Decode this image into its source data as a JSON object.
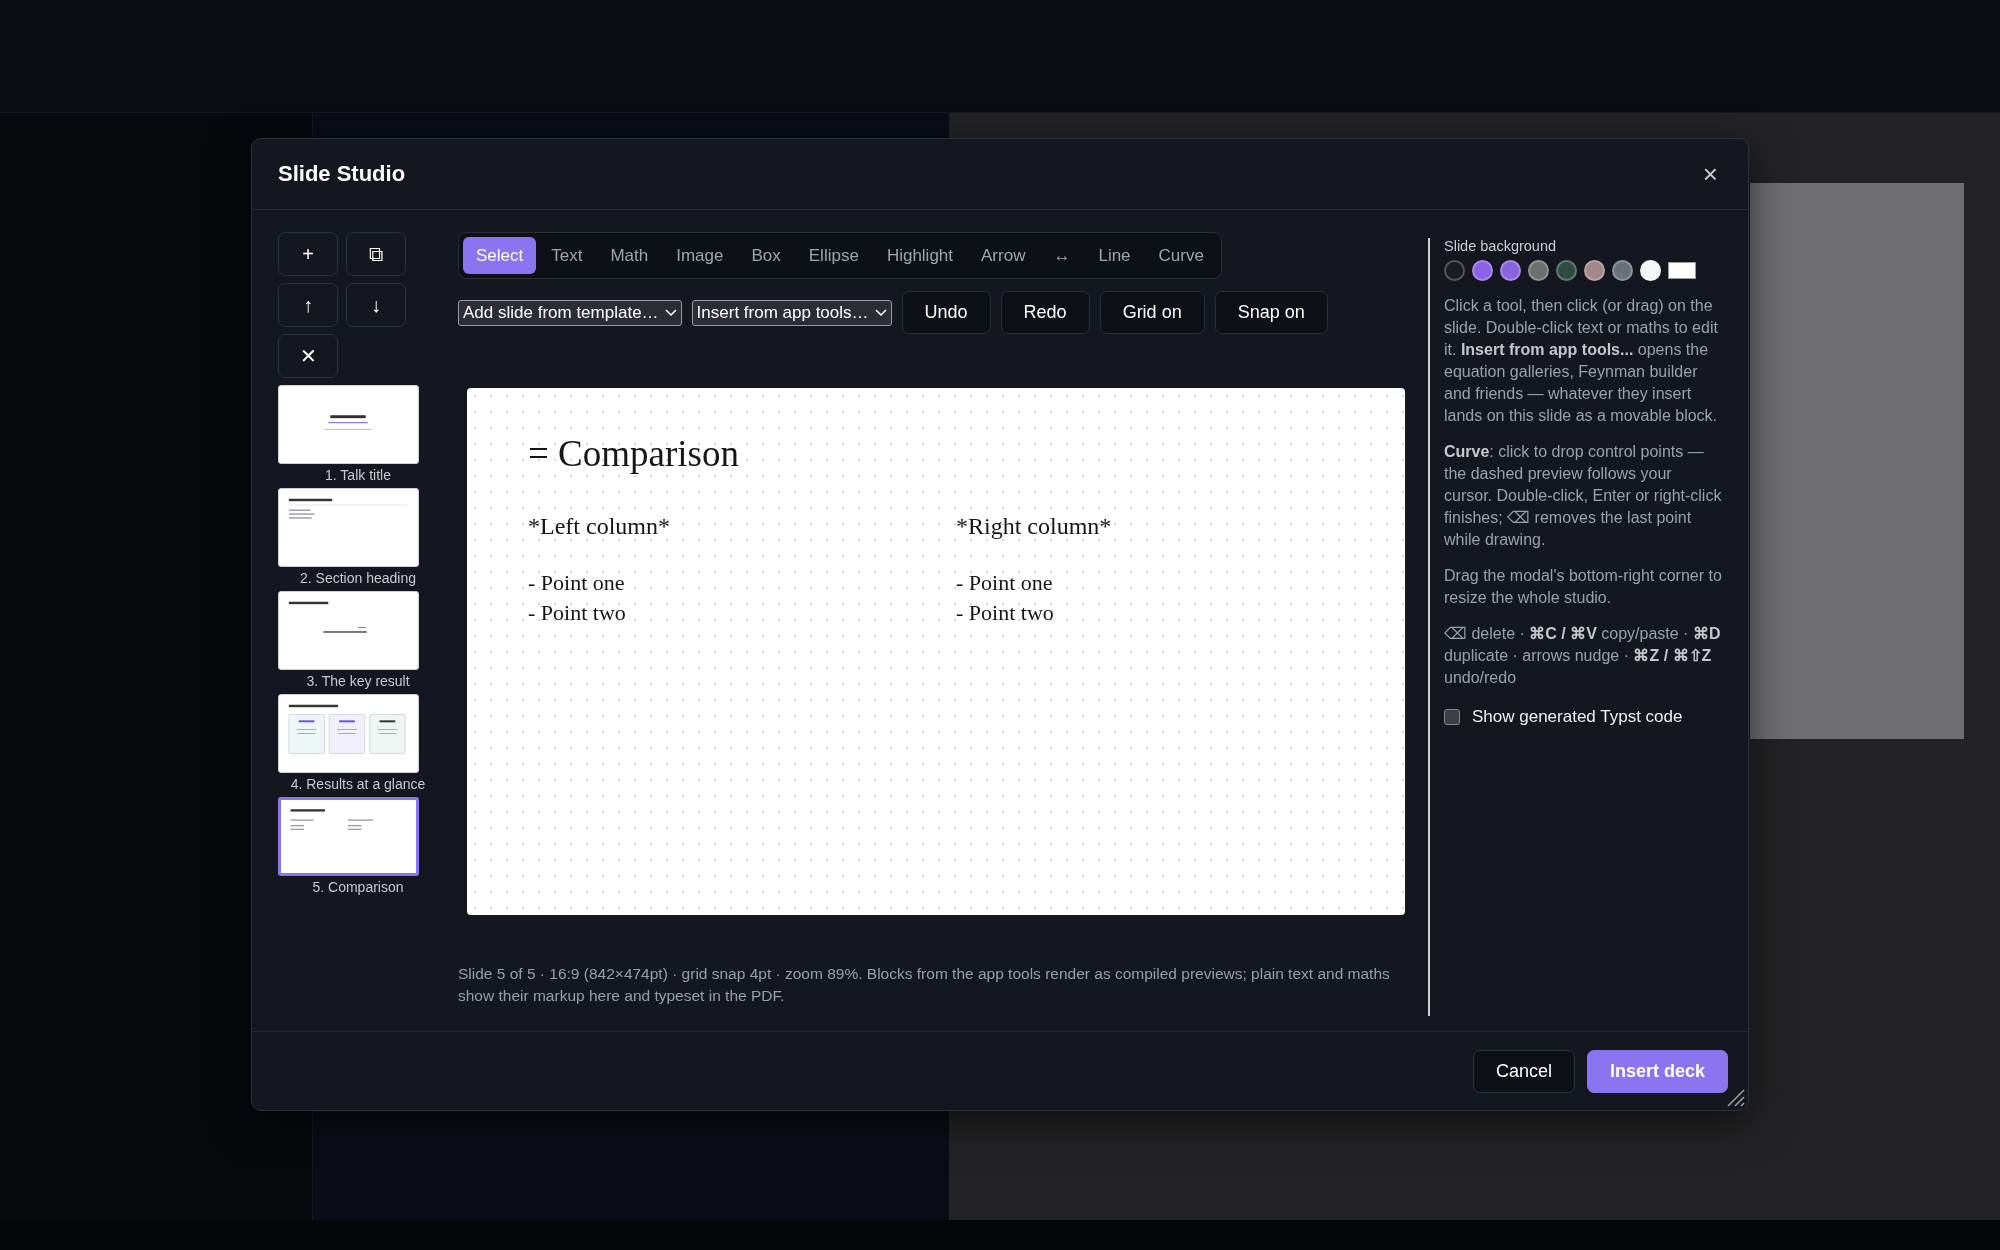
{
  "modal": {
    "title": "Slide Studio",
    "close": "×",
    "slide_actions": [
      "+",
      "⧉",
      "↑",
      "↓",
      "✕"
    ],
    "slides": [
      {
        "kind": "title",
        "label": "1. Talk title",
        "selected": false
      },
      {
        "kind": "bullets",
        "label": "2. Section heading",
        "selected": false
      },
      {
        "kind": "equation",
        "label": "3. The key result",
        "selected": false
      },
      {
        "kind": "stats",
        "label": "4. Results at a glance",
        "selected": false,
        "cards": [
          {
            "color": "#eef7f8"
          },
          {
            "color": "#f1effb"
          },
          {
            "color": "#eef6f4"
          }
        ]
      },
      {
        "kind": "columns",
        "label": "5. Comparison",
        "selected": true
      }
    ],
    "tools": [
      {
        "label": "Select",
        "selected": true
      },
      {
        "label": "Text",
        "selected": false
      },
      {
        "label": "Math",
        "selected": false
      },
      {
        "label": "Image",
        "selected": false
      },
      {
        "label": "Box",
        "selected": false
      },
      {
        "label": "Ellipse",
        "selected": false
      },
      {
        "label": "Highlight",
        "selected": false
      },
      {
        "label": "Arrow",
        "selected": false
      },
      {
        "label": "↔",
        "selected": false
      },
      {
        "label": "Line",
        "selected": false
      },
      {
        "label": "Curve",
        "selected": false
      }
    ],
    "dropdowns": [
      "Add slide from template…",
      "Insert from app tools…"
    ],
    "actions": [
      "Undo",
      "Redo",
      "Grid on",
      "Snap on"
    ],
    "slide": {
      "heading": "= Comparison",
      "columns": [
        {
          "title": "*Left column*",
          "items": [
            "- Point one",
            "- Point two"
          ]
        },
        {
          "title": "*Right column*",
          "items": [
            "- Point one",
            "- Point two"
          ]
        }
      ]
    },
    "caption": "Slide 5 of 5 · 16:9 (842×474pt) · grid snap 4pt · zoom 89%. Blocks from the app tools render as compiled previews; plain text and maths show their markup here and typeset in the PDF.",
    "background": {
      "label": "Slide background",
      "swatches": [
        {
          "kind": "dot",
          "color": "#1a1c24"
        },
        {
          "kind": "dot",
          "color": "#8b62e6"
        },
        {
          "kind": "dot",
          "color": "#8a64de"
        },
        {
          "kind": "dot",
          "color": "#6e6e6e"
        },
        {
          "kind": "dot",
          "color": "#2c4d3f"
        },
        {
          "kind": "dot",
          "color": "#a58689"
        },
        {
          "kind": "dot",
          "color": "#6b7079"
        },
        {
          "kind": "dot",
          "color": "#f6f6f8"
        },
        {
          "kind": "picker",
          "color": "#ffffff"
        }
      ]
    },
    "help": [
      "Click a tool, then click (or drag) on the slide. Double-click text or maths to edit it. **Insert from app tools...** opens the equation galleries, Feynman builder and friends — whatever they insert lands on this slide as a movable block.",
      "**Curve**: click to drop control points — the dashed preview follows your cursor. Double-click, Enter or right-click finishes; ⌫ removes the last point while drawing.",
      "Drag the modal's bottom-right corner to resize the whole studio.",
      "⌫ delete · **⌘C / ⌘V** copy/paste · **⌘D** duplicate · arrows nudge · **⌘Z / ⌘⇧Z** undo/redo"
    ],
    "show_code": {
      "label": "Show generated Typst code",
      "checked": false
    },
    "footer_buttons": [
      {
        "label": "Cancel",
        "kind": "secondary"
      },
      {
        "label": "Insert deck",
        "kind": "primary"
      }
    ]
  }
}
